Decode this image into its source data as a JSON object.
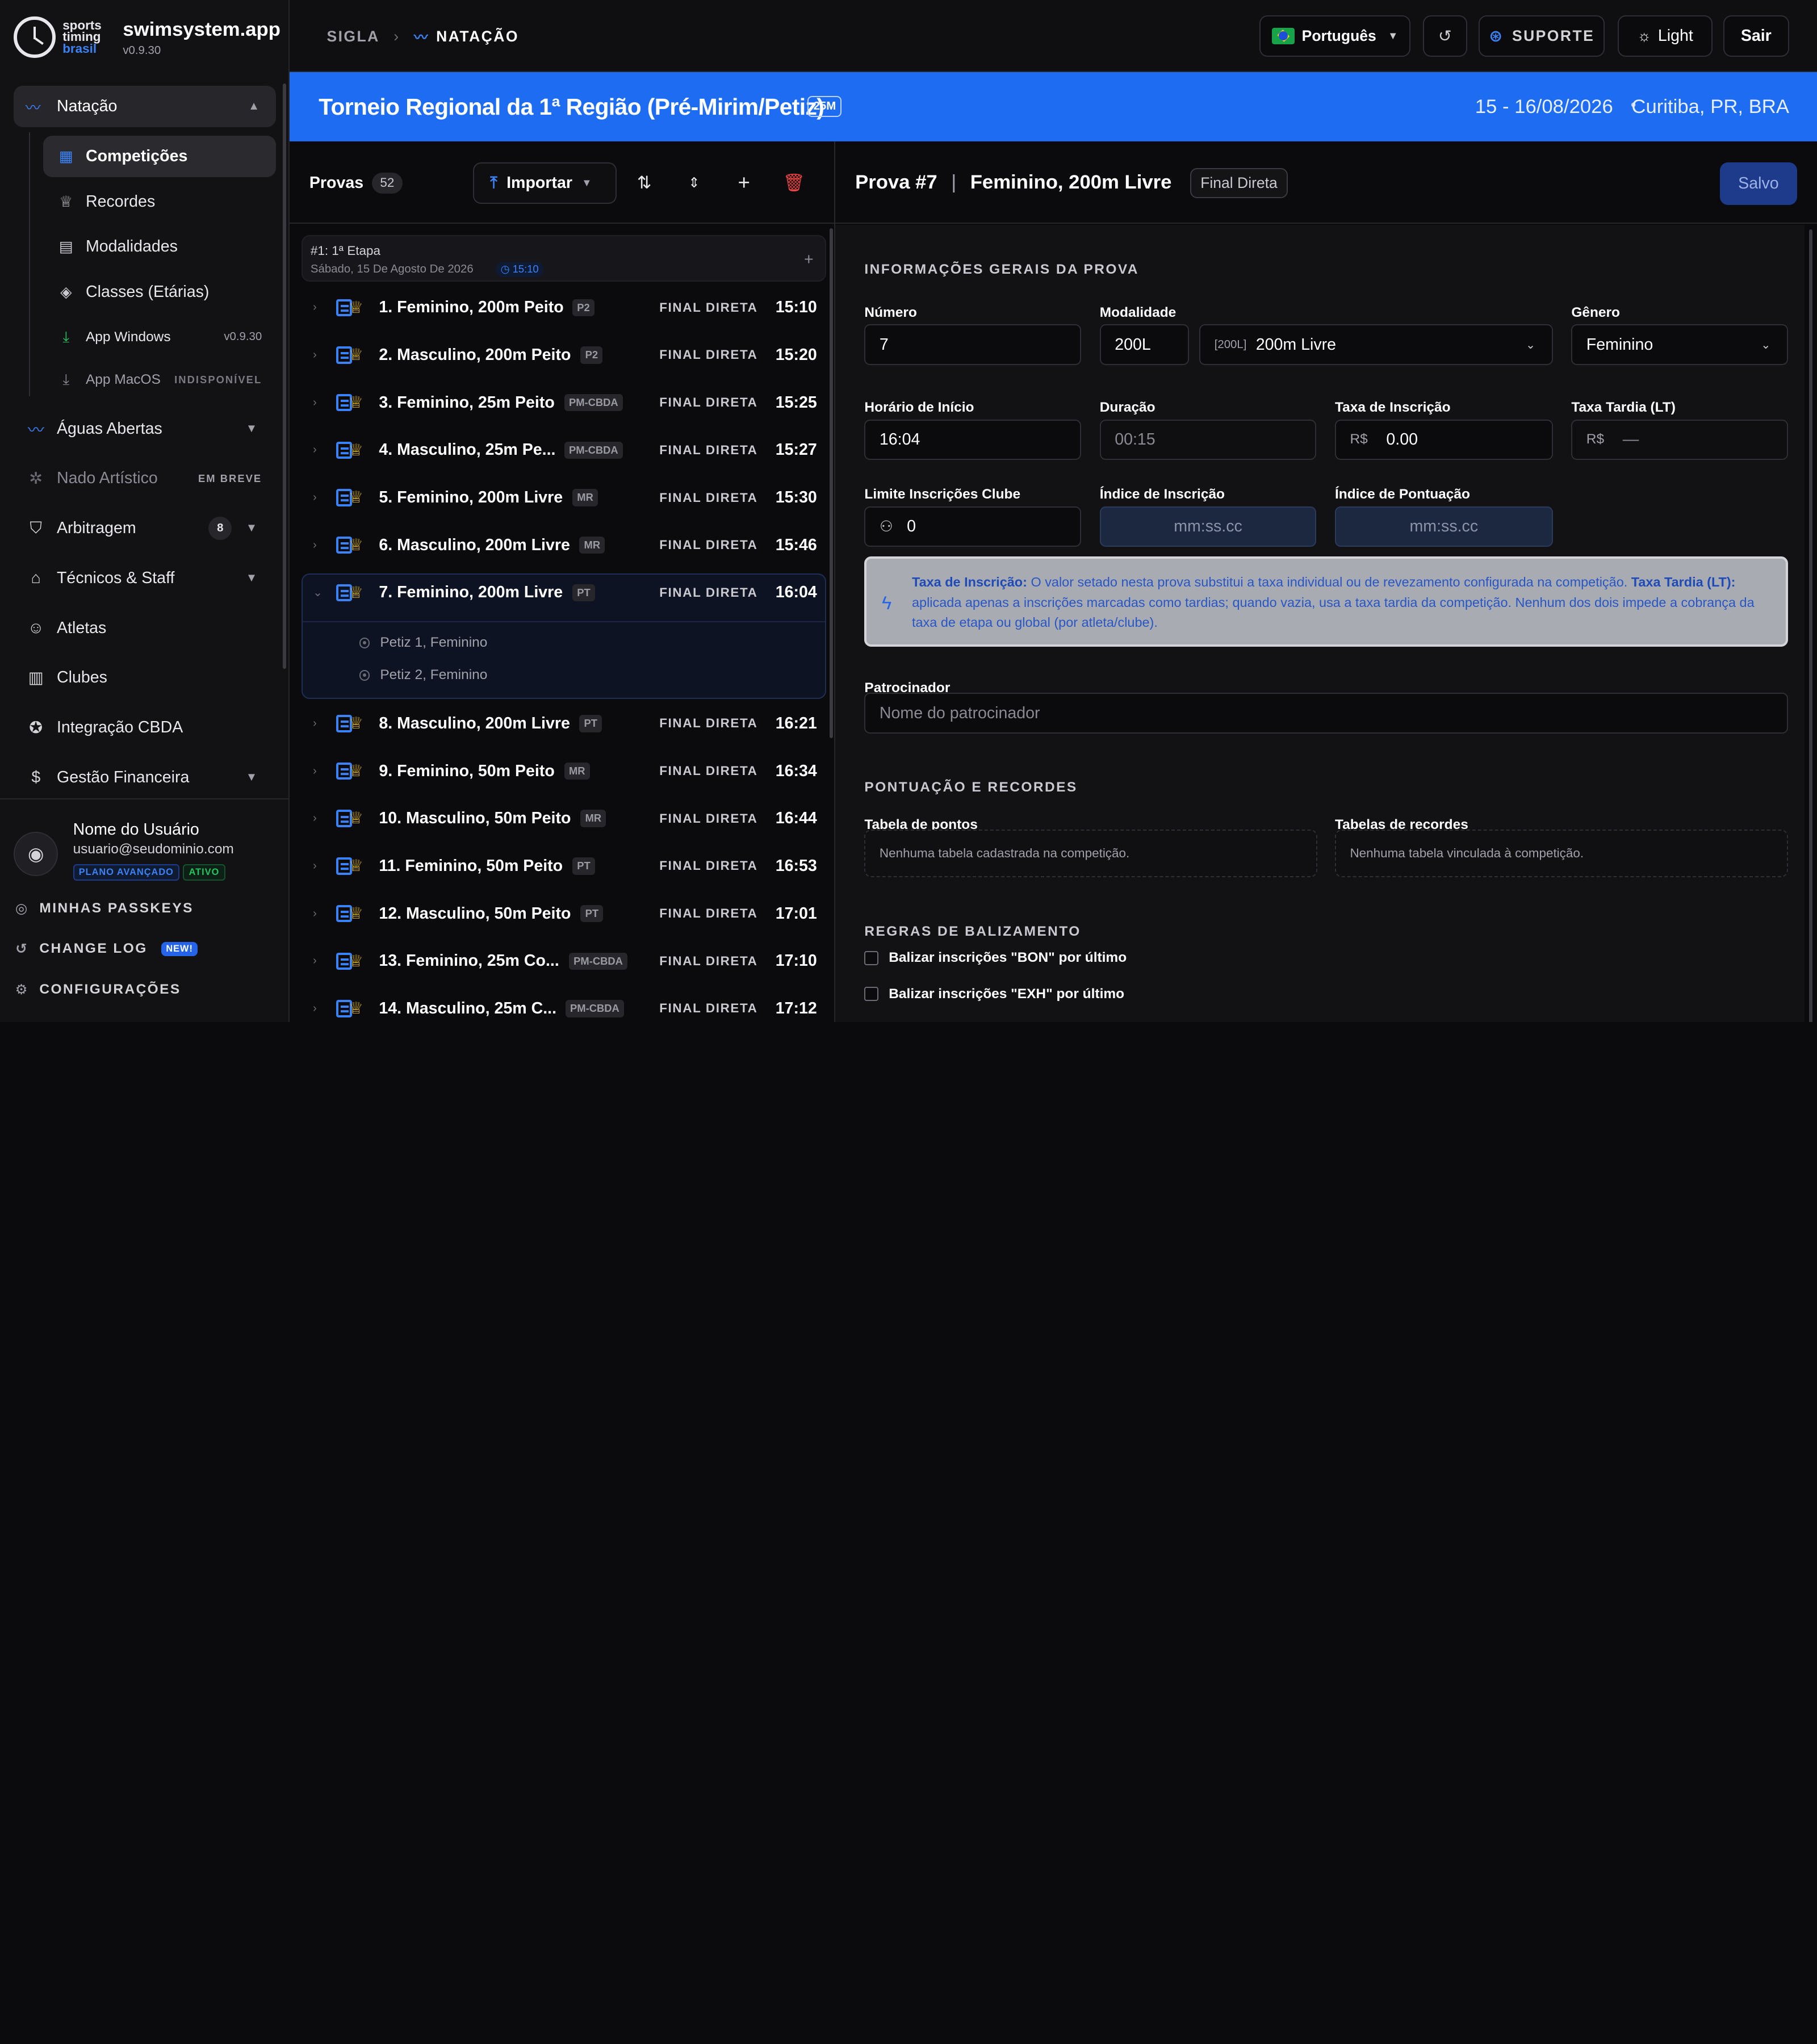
{
  "brand": {
    "words": [
      "sports",
      "timing",
      "brasil"
    ],
    "name": "swimsystem.app",
    "version": "v0.9.30"
  },
  "sidebar": {
    "top_item": {
      "label": "Natação",
      "icon": "swimmer-icon"
    },
    "sub_items": [
      {
        "label": "Competições",
        "icon": "calendar-icon",
        "active": true
      },
      {
        "label": "Recordes",
        "icon": "trophy-icon"
      },
      {
        "label": "Modalidades",
        "icon": "book-icon"
      },
      {
        "label": "Classes (Etárias)",
        "icon": "layers-icon"
      },
      {
        "label": "App Windows",
        "icon": "download-icon",
        "right": "v0.9.30"
      },
      {
        "label": "App MacOS",
        "icon": "download-icon",
        "right": "INDISPONÍVEL"
      }
    ],
    "items": [
      {
        "label": "Águas Abertas",
        "icon": "open-water-icon"
      },
      {
        "label": "Nado Artístico",
        "icon": "artistic-swim-icon",
        "pill": "EM BREVE"
      },
      {
        "label": "Arbitragem",
        "icon": "shield-icon",
        "count": "8"
      },
      {
        "label": "Técnicos & Staff",
        "icon": "graduation-cap-icon"
      },
      {
        "label": "Atletas",
        "icon": "users-icon"
      },
      {
        "label": "Clubes",
        "icon": "building-icon"
      },
      {
        "label": "Integração CBDA",
        "icon": "seal-icon"
      },
      {
        "label": "Gestão Financeira",
        "icon": "dollar-icon"
      }
    ],
    "user": {
      "name": "Nome do Usuário",
      "email": "usuario@seudominio.com",
      "plan": "PLANO AVANÇADO",
      "status": "ATIVO"
    },
    "footer": [
      {
        "label": "MINHAS PASSKEYS",
        "icon": "fingerprint-icon"
      },
      {
        "label": "CHANGE LOG",
        "icon": "history-icon",
        "badge": "NEW!"
      },
      {
        "label": "CONFIGURAÇÕES",
        "icon": "gear-icon"
      }
    ]
  },
  "topbar": {
    "breadcrumb": [
      "SIGLA",
      "NATAÇÃO"
    ],
    "language": "Português",
    "support": "SUPORTE",
    "theme": "Light",
    "logout": "Sair"
  },
  "banner": {
    "title": "Torneio Regional da 1ª Região (Pré-Mirim/Petiz)",
    "pool": "25M",
    "dates": "15 - 16/08/2026",
    "separator": "•",
    "location": "Curitiba, PR, BRA"
  },
  "list": {
    "title": "Provas",
    "count": "52",
    "import_label": "Importar",
    "stage": {
      "title": "#1: 1ª Etapa",
      "date": "Sábado, 15 De Agosto De 2026",
      "time": "15:10"
    },
    "events": [
      {
        "name": "1. Feminino, 200m Peito",
        "tag": "P2",
        "kind": "FINAL DIRETA",
        "time": "15:10"
      },
      {
        "name": "2. Masculino, 200m Peito",
        "tag": "P2",
        "kind": "FINAL DIRETA",
        "time": "15:20"
      },
      {
        "name": "3. Feminino, 25m Peito",
        "tag": "PM-CBDA",
        "kind": "FINAL DIRETA",
        "time": "15:25"
      },
      {
        "name": "4. Masculino, 25m Pe...",
        "tag": "PM-CBDA",
        "kind": "FINAL DIRETA",
        "time": "15:27"
      },
      {
        "name": "5. Feminino, 200m Livre",
        "tag": "MR",
        "kind": "FINAL DIRETA",
        "time": "15:30"
      },
      {
        "name": "6. Masculino, 200m Livre",
        "tag": "MR",
        "kind": "FINAL DIRETA",
        "time": "15:46"
      },
      {
        "name": "7. Feminino, 200m Livre",
        "tag": "PT",
        "kind": "FINAL DIRETA",
        "time": "16:04",
        "selected": true,
        "classes": [
          "Petiz 1, Feminino",
          "Petiz 2, Feminino"
        ]
      },
      {
        "name": "8. Masculino, 200m Livre",
        "tag": "PT",
        "kind": "FINAL DIRETA",
        "time": "16:21"
      },
      {
        "name": "9. Feminino, 50m Peito",
        "tag": "MR",
        "kind": "FINAL DIRETA",
        "time": "16:34"
      },
      {
        "name": "10. Masculino, 50m Peito",
        "tag": "MR",
        "kind": "FINAL DIRETA",
        "time": "16:44"
      },
      {
        "name": "11. Feminino, 50m Peito",
        "tag": "PT",
        "kind": "FINAL DIRETA",
        "time": "16:53"
      },
      {
        "name": "12. Masculino, 50m Peito",
        "tag": "PT",
        "kind": "FINAL DIRETA",
        "time": "17:01"
      },
      {
        "name": "13. Feminino, 25m Co...",
        "tag": "PM-CBDA",
        "kind": "FINAL DIRETA",
        "time": "17:10"
      },
      {
        "name": "14. Masculino, 25m C...",
        "tag": "PM-CBDA",
        "kind": "FINAL DIRETA",
        "time": "17:12"
      }
    ]
  },
  "detail": {
    "event_no": "Prova #7",
    "separator": "|",
    "event_name": "Feminino, 200m Livre",
    "type_tag": "Final Direta",
    "save_label": "Salvo",
    "general_section": "INFORMAÇÕES GERAIS DA PROVA",
    "numero": {
      "label": "Número",
      "value": "7"
    },
    "modalidade": {
      "label": "Modalidade",
      "code": "200L",
      "prefix": "[200L]",
      "value": "200m Livre"
    },
    "genero": {
      "label": "Gênero",
      "value": "Feminino"
    },
    "horario": {
      "label": "Horário de Início",
      "value": "16:04"
    },
    "duracao": {
      "label": "Duração",
      "value": "00:15"
    },
    "taxa": {
      "label": "Taxa de Inscrição",
      "currency": "R$",
      "value": "0.00"
    },
    "taxa_tardia": {
      "label": "Taxa Tardia (LT)",
      "currency": "R$",
      "value": "—"
    },
    "limite": {
      "label": "Limite Inscrições Clube",
      "value": "0"
    },
    "indice_inscricao": {
      "label": "Índice de Inscrição",
      "placeholder": "mm:ss.cc"
    },
    "indice_pontuacao": {
      "label": "Índice de Pontuação",
      "placeholder": "mm:ss.cc"
    },
    "info": {
      "b1": "Taxa de Inscrição:",
      "t1": " O valor setado nesta prova substitui a taxa individual ou de revezamento configurada na competição. ",
      "b2": "Taxa Tardia (LT):",
      "t2": " aplicada apenas a inscrições marcadas como tardias; quando vazia, usa a taxa tardia da competição. Nenhum dos dois impede a cobrança da taxa de etapa ou global (por atleta/clube)."
    },
    "sponsor": {
      "label": "Patrocinador",
      "placeholder": "Nome do patrocinador"
    },
    "score_section": "PONTUAÇÃO E RECORDES",
    "points_table": {
      "label": "Tabela de pontos",
      "empty": "Nenhuma tabela cadastrada na competição."
    },
    "records_table": {
      "label": "Tabelas de recordes",
      "empty": "Nenhuma tabela vinculada à competição."
    },
    "seeding_section": "REGRAS DE BALIZAMENTO",
    "rules": [
      "Balizar inscrições \"BON\" por último",
      "Balizar inscrições \"EXH\" por último"
    ]
  }
}
